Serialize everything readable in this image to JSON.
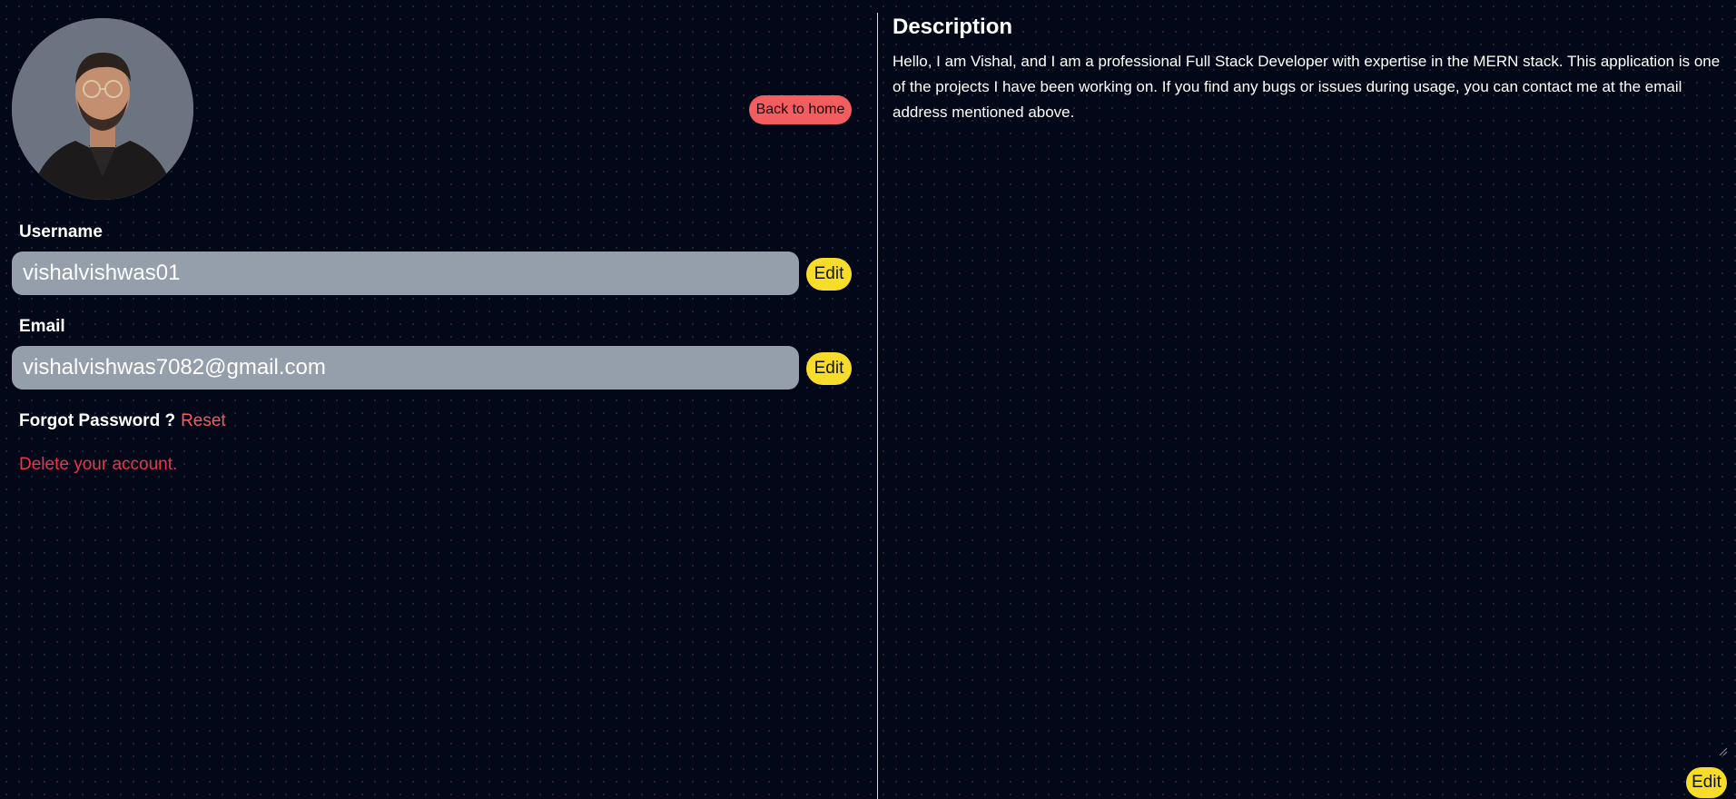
{
  "profile": {
    "avatar_alt": "Profile photo",
    "back_button_label": "Back to home"
  },
  "username": {
    "label": "Username",
    "value": "vishalvishwas01",
    "edit_label": "Edit"
  },
  "email": {
    "label": "Email",
    "value": "vishalvishwas7082@gmail.com",
    "edit_label": "Edit"
  },
  "password": {
    "label": "Forgot Password ?",
    "reset_label": "Reset"
  },
  "account": {
    "delete_label": "Delete your account."
  },
  "description": {
    "title": "Description",
    "text": "Hello, I am Vishal, and I am a professional Full Stack Developer with expertise in the MERN stack. This application is one of the projects I have been working on. If you find any bugs or issues during usage, you can contact me at the email address mentioned above.",
    "edit_label": "Edit"
  },
  "colors": {
    "background": "#020817",
    "accent_red": "#f35d5f",
    "delete_red": "#f0334b",
    "edit_yellow": "#f7dc2a",
    "input_gray": "#959eab"
  },
  "icons": {
    "resize": "resize-handle-icon"
  }
}
